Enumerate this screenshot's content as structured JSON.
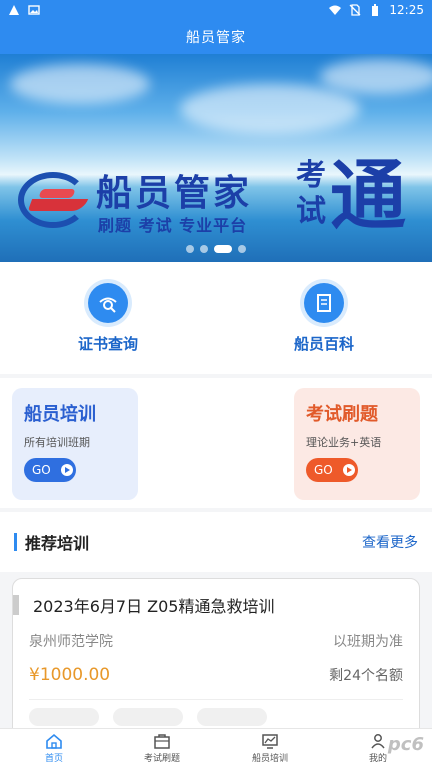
{
  "status_bar": {
    "time": "12:25"
  },
  "app": {
    "title": "船员管家"
  },
  "banner": {
    "title": "船员管家",
    "subtitle": "刷题  考试  专业平台",
    "side_small": "考试",
    "side_big": "通",
    "slide_count": 4,
    "active_slide": 3
  },
  "quick_links": [
    {
      "label": "证书查询",
      "icon": "search-certificate-icon"
    },
    {
      "label": "船员百科",
      "icon": "book-icon"
    }
  ],
  "cards": [
    {
      "title": "船员培训",
      "subtitle": "所有培训班期",
      "button": "GO",
      "color": "#2f6fe0"
    },
    {
      "title": "考试刷题",
      "subtitle": "理论业务+英语",
      "button": "GO",
      "color": "#ee5a2a"
    }
  ],
  "section": {
    "title": "推荐培训",
    "more": "查看更多"
  },
  "course": {
    "title": "2023年6月7日 Z05精通急救培训",
    "school": "泉州师范学院",
    "schedule": "以班期为准",
    "price": "¥1000.00",
    "quota": "剩24个名额"
  },
  "tabs": [
    {
      "label": "首页",
      "icon": "home-icon",
      "active": true
    },
    {
      "label": "考试刷题",
      "icon": "briefcase-icon",
      "active": false
    },
    {
      "label": "船员培训",
      "icon": "chart-icon",
      "active": false
    },
    {
      "label": "我的",
      "icon": "user-icon",
      "active": false
    }
  ],
  "watermark": "pc6"
}
